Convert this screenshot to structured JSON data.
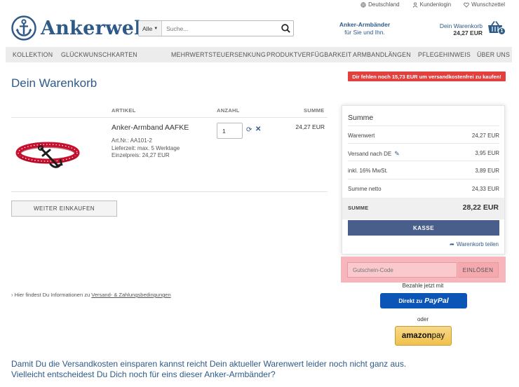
{
  "toplinks": [
    {
      "label": "Deutschland",
      "icon": "globe-icon"
    },
    {
      "label": "Kundenlogin",
      "icon": "user-icon"
    },
    {
      "label": "Wunschzettel",
      "icon": "heart-icon"
    }
  ],
  "header": {
    "logo_text": "Ankerwelt",
    "search": {
      "category": "Alle",
      "placeholder": "Suche..."
    },
    "tagline": {
      "line1": "Anker-Armbänder",
      "line2": "für Sie und Ihn."
    },
    "cart": {
      "label": "Dein Warenkorb",
      "amount": "24,27 EUR",
      "count": "1"
    }
  },
  "nav": [
    "KOLLEKTION",
    "GLÜCKWUNSCHKARTEN",
    "MEHRWERTSTEUERSENKUNG",
    "PRODUKTVERFÜGBARKEIT",
    "ARMBANDLÄNGEN",
    "PFLEGEHINWEIS",
    "ÜBER UNS"
  ],
  "notice": "Dir fehlen noch 15,73 EUR um versandkostenfrei zu kaufen!",
  "page_title": "Dein Warenkorb",
  "table": {
    "headers": {
      "article": "ARTIKEL",
      "quantity": "ANZAHL",
      "sum": "SUMME"
    },
    "item": {
      "name": "Anker-Armband AAFKE",
      "art_nr": "Art.Nr.: AA101-2",
      "delivery": "Lieferzeit: max. 5 Werktage",
      "unit_price": "Einzelpreis: 24,27 EUR",
      "quantity": "1",
      "price": "24,27 EUR"
    }
  },
  "continue_button": "WEITER EINKAUFEN",
  "info": {
    "prefix": "Hier findest Du Informationen zu ",
    "link": "Versand- & Zahlungsbedingungen"
  },
  "summary": {
    "title": "Summe",
    "rows": [
      {
        "label": "Warenwert",
        "value": "24,27 EUR"
      },
      {
        "label": "Versand nach DE",
        "value": "3,95 EUR"
      },
      {
        "label": "inkl. 16% MwSt.",
        "value": "3,89 EUR"
      },
      {
        "label": "Summe netto",
        "value": "24,33 EUR"
      }
    ],
    "total_label": "SUMME",
    "total_value": "28,22 EUR",
    "checkout_button": "KASSE",
    "share": "Warenkorb teilen"
  },
  "voucher": {
    "placeholder": "Gutschein-Code",
    "button": "EINLÖSEN"
  },
  "payment": {
    "pay_now": "Bezahle jetzt mit",
    "paypal_prefix": "Direkt zu",
    "paypal_brand": "PayPal",
    "or": "oder",
    "amazon_1": "amazon",
    "amazon_2": " pay"
  },
  "bottom_message": {
    "line1": "Damit Du die Versandkosten einsparen kannst reicht Dein aktueller Warenwert leider noch nicht ganz aus.",
    "line2": "Vielleicht entscheidest Du Dich noch für eins dieser Anker-Armbänder?"
  },
  "colors": {
    "brand": "#2e5a8a",
    "notice": "#e2403f",
    "checkout": "#4a5e8c",
    "paypal": "#0a55b5"
  }
}
